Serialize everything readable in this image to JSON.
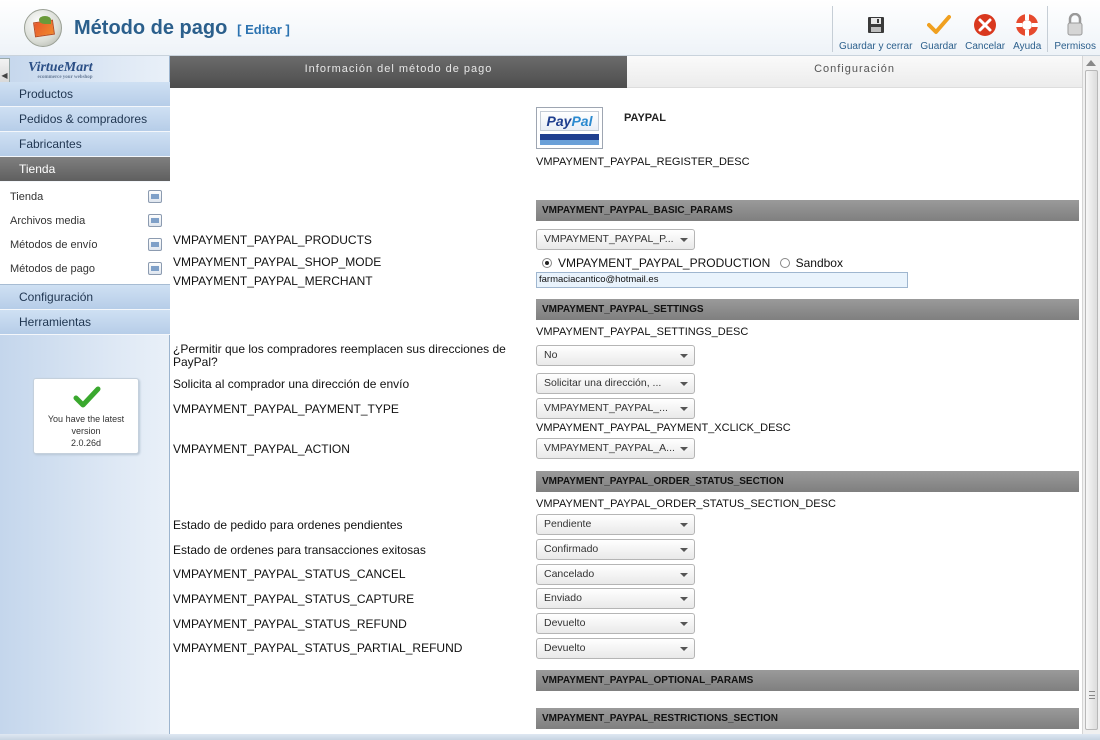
{
  "header": {
    "title": "Método de pago",
    "edit_tag": "[ Editar ]",
    "toolbar": [
      {
        "label": "Guardar y cerrar",
        "icon": "save-icon"
      },
      {
        "label": "Guardar",
        "icon": "check-icon"
      },
      {
        "label": "Cancelar",
        "icon": "cancel-icon"
      },
      {
        "label": "Ayuda",
        "icon": "help-icon"
      },
      {
        "label": "Permisos",
        "icon": "lock-icon"
      }
    ]
  },
  "sidebar": {
    "brand": "VirtueMart",
    "brand_sub": "ecommerce your webshop",
    "items": [
      {
        "label": "Productos"
      },
      {
        "label": "Pedidos & compradores"
      },
      {
        "label": "Fabricantes"
      },
      {
        "label": "Tienda",
        "active": true
      }
    ],
    "subitems": [
      {
        "label": "Tienda",
        "icon": "store-icon"
      },
      {
        "label": "Archivos media",
        "icon": "media-icon"
      },
      {
        "label": "Métodos de envío",
        "icon": "truck-icon"
      },
      {
        "label": "Métodos de pago",
        "icon": "payment-icon"
      }
    ],
    "items2": [
      {
        "label": "Configuración"
      },
      {
        "label": "Herramientas"
      }
    ],
    "version": {
      "line1": "You have the latest",
      "line2": "version",
      "line3": "2.0.26d"
    }
  },
  "tabs": [
    {
      "label": "Información del método de pago",
      "active": false
    },
    {
      "label": "Configuración",
      "active": true
    }
  ],
  "form": {
    "plugin_name": "PAYPAL",
    "register_desc": "VMPAYMENT_PAYPAL_REGISTER_DESC",
    "sections": {
      "basic": "VMPAYMENT_PAYPAL_BASIC_PARAMS",
      "settings": "VMPAYMENT_PAYPAL_SETTINGS",
      "order_status": "VMPAYMENT_PAYPAL_ORDER_STATUS_SECTION",
      "optional": "VMPAYMENT_PAYPAL_OPTIONAL_PARAMS",
      "restrictions": "VMPAYMENT_PAYPAL_RESTRICTIONS_SECTION"
    },
    "settings_desc": "VMPAYMENT_PAYPAL_SETTINGS_DESC",
    "payment_xclick_desc": "VMPAYMENT_PAYPAL_PAYMENT_XCLICK_DESC",
    "order_status_desc": "VMPAYMENT_PAYPAL_ORDER_STATUS_SECTION_DESC",
    "products": {
      "label": "VMPAYMENT_PAYPAL_PRODUCTS",
      "value": "VMPAYMENT_PAYPAL_P..."
    },
    "shop_mode": {
      "label": "VMPAYMENT_PAYPAL_SHOP_MODE",
      "option1": "VMPAYMENT_PAYPAL_PRODUCTION",
      "option2": "Sandbox",
      "selected": "VMPAYMENT_PAYPAL_PRODUCTION"
    },
    "merchant": {
      "label": "VMPAYMENT_PAYPAL_MERCHANT",
      "value": "farmaciacantico@hotmail.es"
    },
    "allow_address": {
      "label": "¿Permitir que los compradores reemplacen sus direcciones de PayPal?",
      "value": "No"
    },
    "ask_address": {
      "label": "Solicita al comprador una dirección de envío",
      "value": "Solicitar una dirección, ..."
    },
    "payment_type": {
      "label": "VMPAYMENT_PAYPAL_PAYMENT_TYPE",
      "value": "VMPAYMENT_PAYPAL_..."
    },
    "action": {
      "label": "VMPAYMENT_PAYPAL_ACTION",
      "value": "VMPAYMENT_PAYPAL_A..."
    },
    "status_pending": {
      "label": "Estado de pedido para ordenes pendientes",
      "value": "Pendiente"
    },
    "status_success": {
      "label": "Estado de ordenes para transacciones exitosas",
      "value": "Confirmado"
    },
    "status_cancel": {
      "label": "VMPAYMENT_PAYPAL_STATUS_CANCEL",
      "value": "Cancelado"
    },
    "status_capture": {
      "label": "VMPAYMENT_PAYPAL_STATUS_CAPTURE",
      "value": "Enviado"
    },
    "status_refund": {
      "label": "VMPAYMENT_PAYPAL_STATUS_REFUND",
      "value": "Devuelto"
    },
    "status_partial_refund": {
      "label": "VMPAYMENT_PAYPAL_STATUS_PARTIAL_REFUND",
      "value": "Devuelto"
    }
  },
  "colors": {
    "title": "#2b5f8c",
    "active_tab": "#5a5a5a",
    "section_bar": "#8a8a8a",
    "sidebar": "#c4d6ec"
  }
}
